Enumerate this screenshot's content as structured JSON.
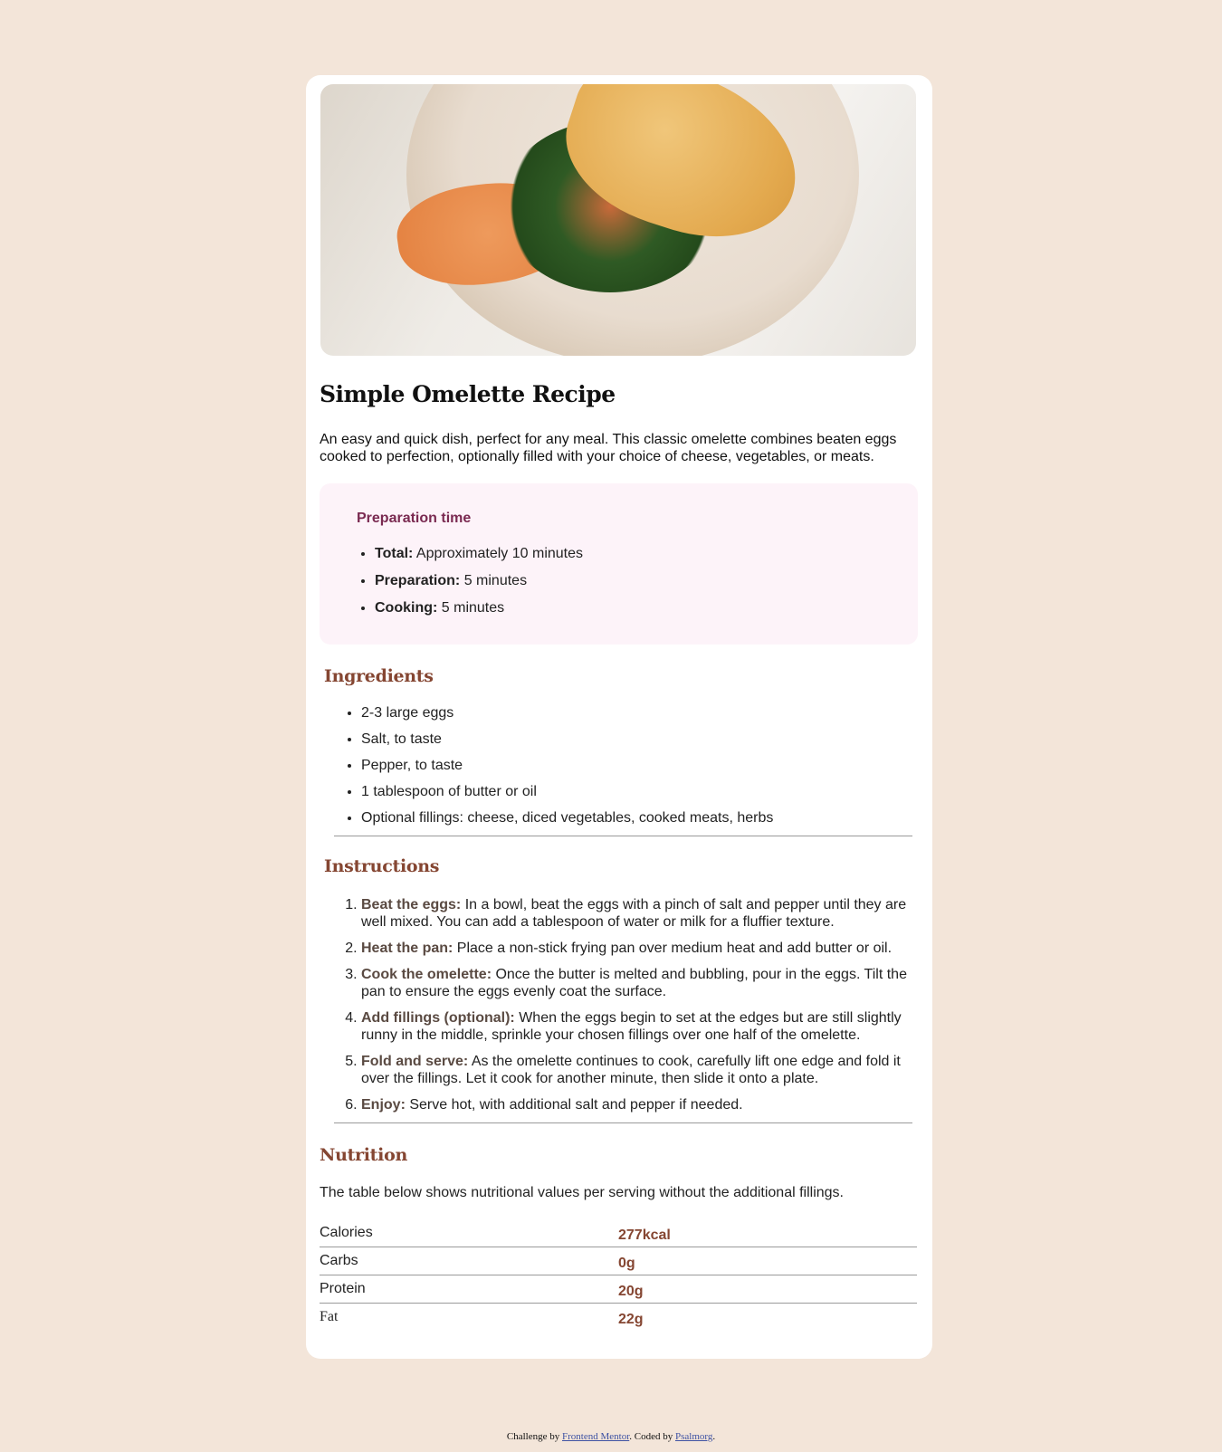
{
  "recipe": {
    "image_alt": "omelette on plate",
    "title": "Simple Omelette Recipe",
    "intro": "An easy and quick dish, perfect for any meal. This classic omelette combines beaten eggs cooked to perfection, optionally filled with your choice of cheese, vegetables, or meats."
  },
  "prep": {
    "title": "Preparation time",
    "items": [
      {
        "label": "Total:",
        "value": " Approximately 10 minutes"
      },
      {
        "label": "Preparation:",
        "value": " 5 minutes"
      },
      {
        "label": "Cooking:",
        "value": " 5 minutes"
      }
    ]
  },
  "ingredients": {
    "title": "Ingredients",
    "items": [
      "2-3 large eggs",
      "Salt, to taste",
      "Pepper, to taste",
      "1 tablespoon of butter or oil",
      "Optional fillings: cheese, diced vegetables, cooked meats, herbs"
    ]
  },
  "instructions": {
    "title": "Instructions",
    "items": [
      {
        "label": "Beat the eggs:",
        "text": " In a bowl, beat the eggs with a pinch of salt and pepper until they are well mixed. You can add a tablespoon of water or milk for a fluffier texture."
      },
      {
        "label": "Heat the pan:",
        "text": " Place a non-stick frying pan over medium heat and add butter or oil."
      },
      {
        "label": "Cook the omelette:",
        "text": " Once the butter is melted and bubbling, pour in the eggs. Tilt the pan to ensure the eggs evenly coat the surface."
      },
      {
        "label": "Add fillings (optional):",
        "text": " When the eggs begin to set at the edges but are still slightly runny in the middle, sprinkle your chosen fillings over one half of the omelette."
      },
      {
        "label": "Fold and serve:",
        "text": " As the omelette continues to cook, carefully lift one edge and fold it over the fillings. Let it cook for another minute, then slide it onto a plate."
      },
      {
        "label": "Enjoy:",
        "text": " Serve hot, with additional salt and pepper if needed."
      }
    ]
  },
  "nutrition": {
    "title": "Nutrition",
    "description": "The table below shows nutritional values per serving without the additional fillings.",
    "rows": [
      {
        "name": "Calories",
        "value": "277kcal"
      },
      {
        "name": "Carbs",
        "value": "0g"
      },
      {
        "name": "Protein",
        "value": "20g"
      },
      {
        "name": "Fat",
        "value": "22g"
      }
    ]
  },
  "footer": {
    "prefix": "Challenge by ",
    "link1": "Frontend Mentor",
    "middle": ". Coded by ",
    "link2": "Psalmorg",
    "suffix": "."
  },
  "colors": {
    "background": "#f3e5d9",
    "accent": "#854632",
    "prep_title": "#7a2a51",
    "prep_bg": "#fdf3f9"
  }
}
